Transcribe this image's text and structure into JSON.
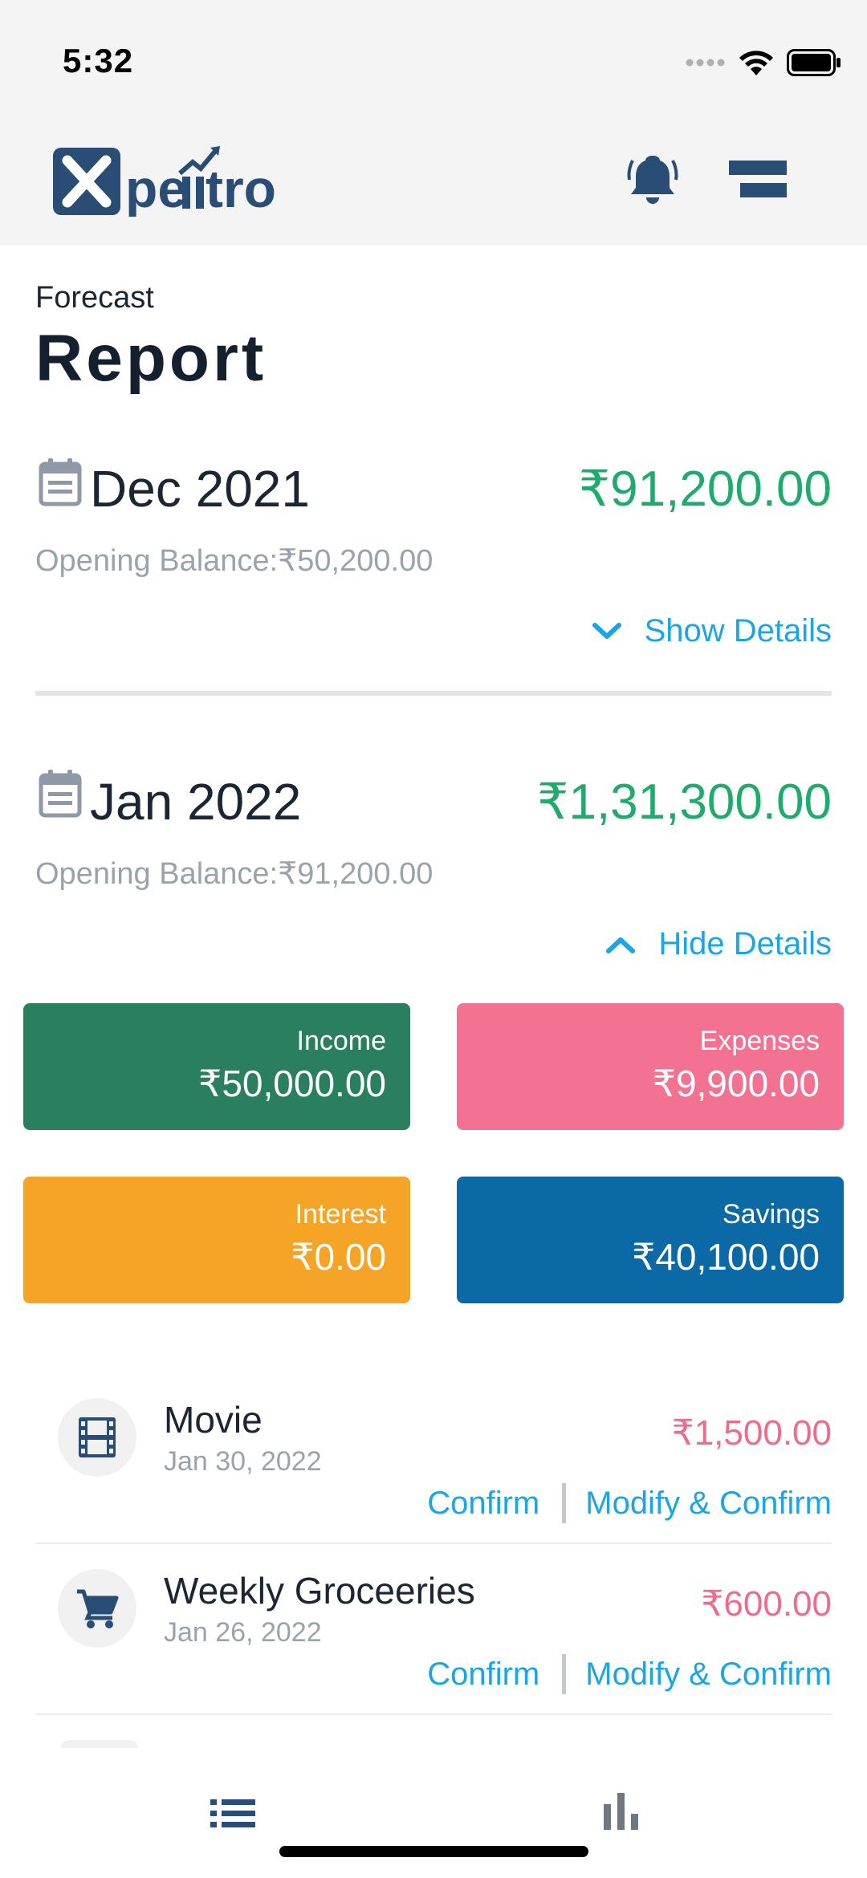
{
  "status_bar": {
    "time": "5:32"
  },
  "header": {
    "logo_text": "Xpentro",
    "icons": [
      "bell-icon",
      "menu-icon"
    ]
  },
  "page": {
    "subtitle": "Forecast",
    "title": "Report"
  },
  "months": [
    {
      "name": "Dec 2021",
      "amount": "₹91,200.00",
      "opening_balance": "Opening Balance:₹50,200.00",
      "toggle_label": "Show Details",
      "expanded": false
    },
    {
      "name": "Jan 2022",
      "amount": "₹1,31,300.00",
      "opening_balance": "Opening Balance:₹91,200.00",
      "toggle_label": "Hide Details",
      "expanded": true
    }
  ],
  "summary_cards": {
    "income": {
      "label": "Income",
      "value": "₹50,000.00",
      "color": "#2a7f5e"
    },
    "expenses": {
      "label": "Expenses",
      "value": "₹9,900.00",
      "color": "#f37191"
    },
    "interest": {
      "label": "Interest",
      "value": "₹0.00",
      "color": "#f5a425"
    },
    "savings": {
      "label": "Savings",
      "value": "₹40,100.00",
      "color": "#0b6aa6"
    }
  },
  "transactions": [
    {
      "name": "Movie",
      "date": "Jan 30, 2022",
      "amount": "₹1,500.00",
      "icon": "film-icon",
      "confirm": "Confirm",
      "modify": "Modify & Confirm"
    },
    {
      "name": "Weekly Groceeries",
      "date": "Jan 26, 2022",
      "amount": "₹600.00",
      "icon": "cart-icon",
      "confirm": "Confirm",
      "modify": "Modify & Confirm"
    }
  ],
  "bottom_nav": {
    "items": [
      "list-icon",
      "bar-chart-icon"
    ]
  },
  "colors": {
    "accent": "#1aa5e6",
    "positive": "#1faa6e",
    "negative": "#ef6b8a",
    "brand": "#2a4d75"
  }
}
